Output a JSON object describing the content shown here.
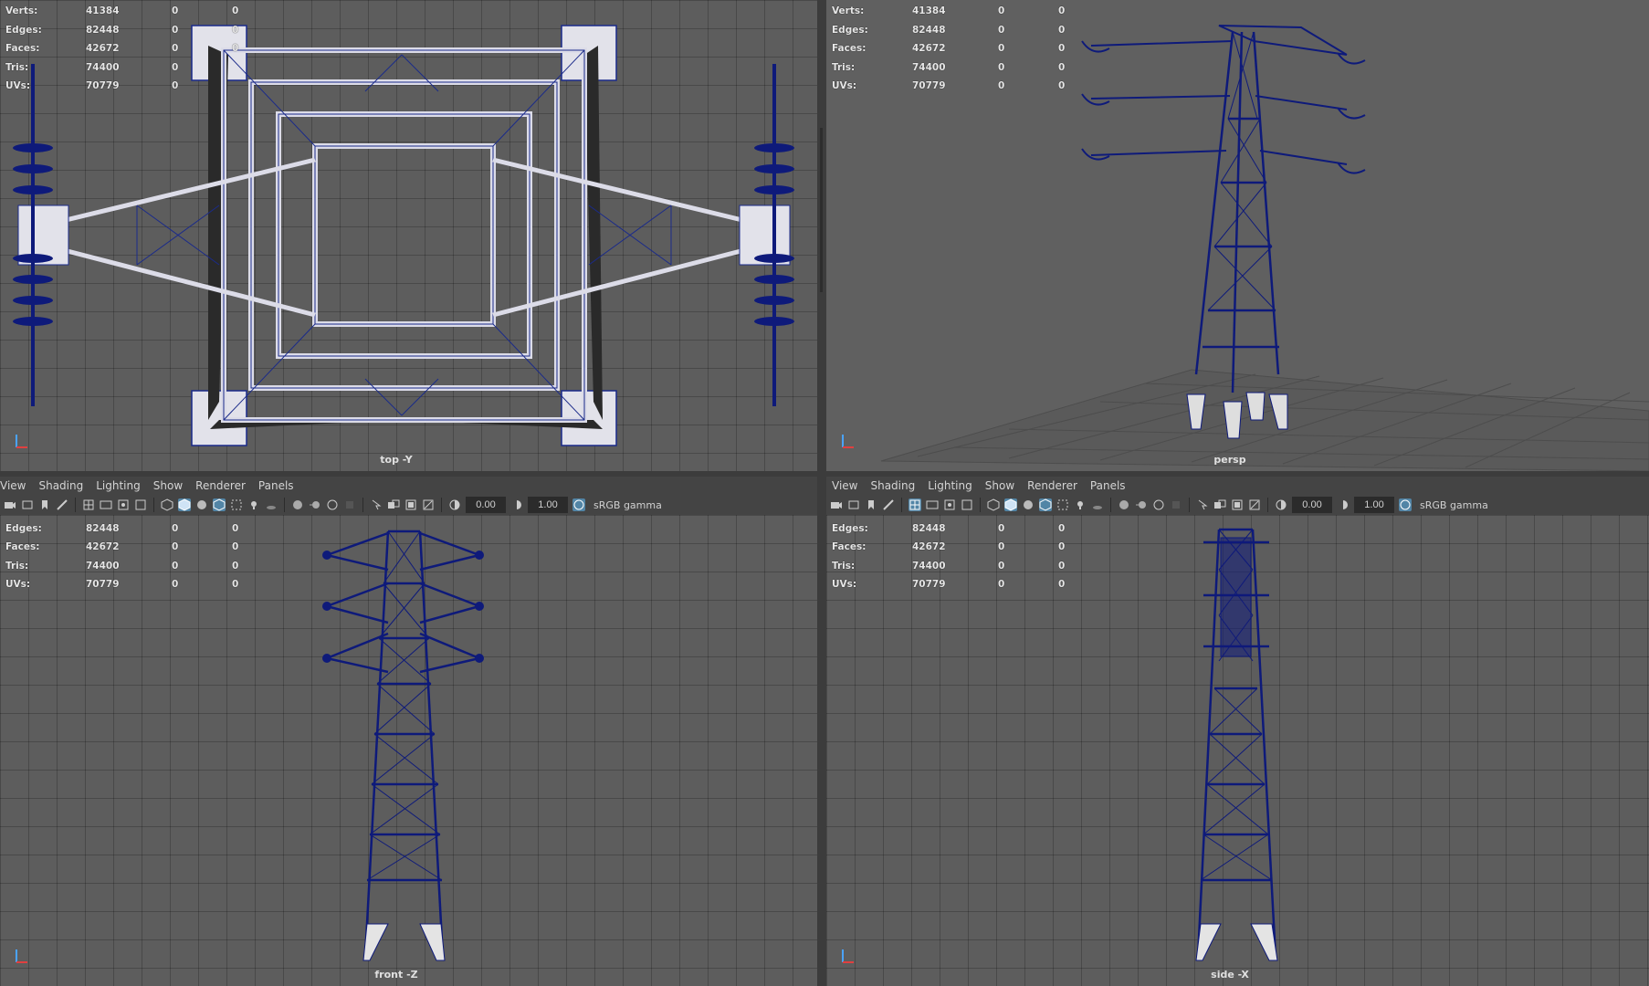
{
  "stats": {
    "rows": [
      {
        "label": "Verts:",
        "count": "41384",
        "sel": "0",
        "extra": "0"
      },
      {
        "label": "Edges:",
        "count": "82448",
        "sel": "0",
        "extra": "0"
      },
      {
        "label": "Faces:",
        "count": "42672",
        "sel": "0",
        "extra": "0"
      },
      {
        "label": "Tris:",
        "count": "74400",
        "sel": "0",
        "extra": ""
      },
      {
        "label": "UVs:",
        "count": "70779",
        "sel": "0",
        "extra": ""
      }
    ]
  },
  "viewports": {
    "top": {
      "label": "top -Y"
    },
    "persp": {
      "label": "persp"
    },
    "front": {
      "label": "front -Z"
    },
    "side": {
      "label": "side -X"
    }
  },
  "menu": {
    "items": [
      "View",
      "Shading",
      "Lighting",
      "Show",
      "Renderer",
      "Panels"
    ]
  },
  "toolbar": {
    "exposure": "0.00",
    "gamma": "1.00",
    "color_space": "sRGB gamma"
  },
  "colors": {
    "viewport_bg": "#5d5d5d",
    "wireframe": "#0e1a7a",
    "mesh_fill": "#e4e4ee",
    "active_icon": "#5285a6"
  }
}
